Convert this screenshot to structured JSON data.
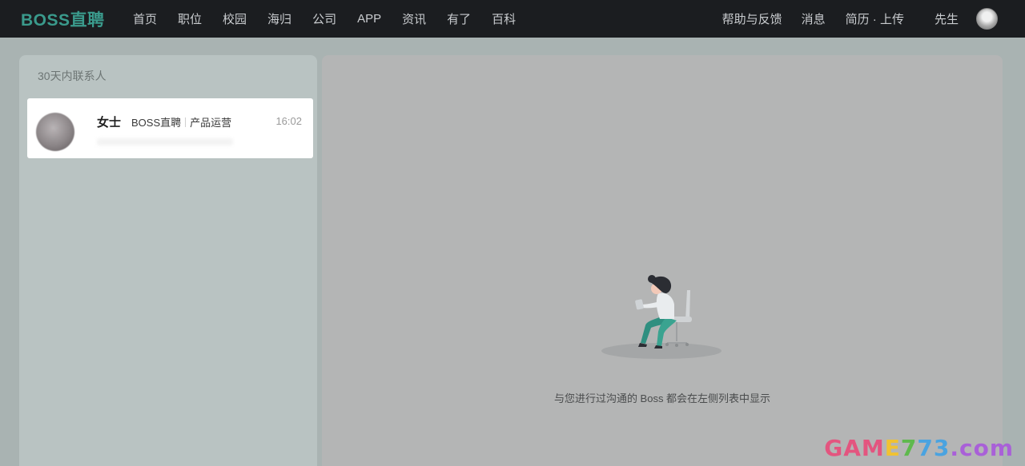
{
  "header": {
    "logo": "BOSS直聘",
    "nav": [
      "首页",
      "职位",
      "校园",
      "海归",
      "公司",
      "APP",
      "资讯",
      "有了",
      "百科"
    ],
    "help": "帮助与反馈",
    "messages": "消息",
    "resume": "简历 · 上传",
    "user_name": "先生"
  },
  "sidebar": {
    "title": "30天内联系人",
    "contacts": [
      {
        "name": "女士",
        "company": "BOSS直聘",
        "position": "产品运营",
        "time": "16:02"
      }
    ]
  },
  "main": {
    "empty_text": "与您进行过沟通的 Boss 都会在左侧列表中显示"
  },
  "watermark": {
    "part1": "GAM",
    "part2": "E",
    "part3": "7",
    "part4": "73",
    "part5": ".com"
  }
}
